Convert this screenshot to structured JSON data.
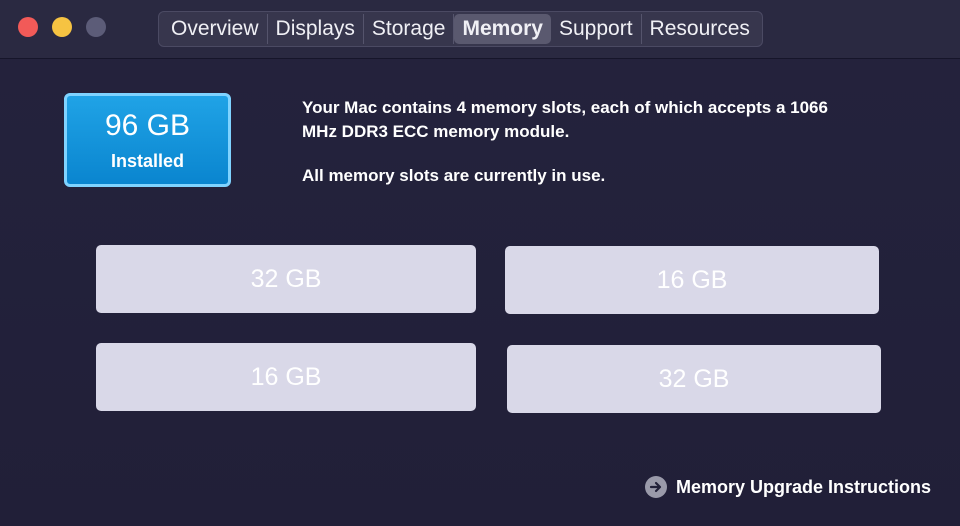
{
  "window": {
    "traffic_lights": {
      "close_color": "#f25a58",
      "minimize_color": "#f6c342",
      "zoom_color": "#5c5c78"
    }
  },
  "tabs": [
    {
      "label": "Overview",
      "active": false
    },
    {
      "label": "Displays",
      "active": false
    },
    {
      "label": "Storage",
      "active": false
    },
    {
      "label": "Memory",
      "active": true
    },
    {
      "label": "Support",
      "active": false
    },
    {
      "label": "Resources",
      "active": false
    }
  ],
  "memory": {
    "installed_amount": "96 GB",
    "installed_label": "Installed",
    "description": "Your Mac contains 4 memory slots, each of which accepts a 1066 MHz DDR3 ECC memory module.",
    "status": "All memory slots are currently in use.",
    "slots": [
      {
        "size": "32 GB"
      },
      {
        "size": "16 GB"
      },
      {
        "size": "16 GB"
      },
      {
        "size": "32 GB"
      }
    ],
    "upgrade_link": "Memory Upgrade Instructions",
    "upgrade_icon": "arrow-right-circle-icon"
  },
  "colors": {
    "accent": "#0a85cf",
    "background": "#22213a",
    "slot": "#d9d8e8"
  }
}
